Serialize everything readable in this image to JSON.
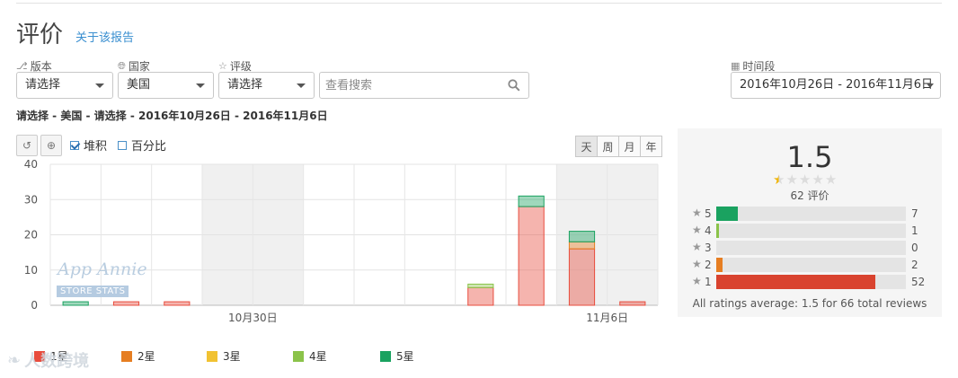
{
  "page": {
    "title": "评价",
    "about_link": "关于该报告",
    "summary": "请选择 - 美国 - 请选择 - 2016年10月26日 - 2016年11月6日"
  },
  "filters": {
    "version": {
      "label": "版本",
      "value": "请选择"
    },
    "country": {
      "label": "国家",
      "value": "美国"
    },
    "rating": {
      "label": "评级",
      "value": "请选择"
    },
    "search_placeholder": "查看搜索",
    "date": {
      "label": "时间段",
      "value": "2016年10月26日 - 2016年11月6日"
    }
  },
  "toolbar": {
    "stacked_label": "堆积",
    "stacked_checked": true,
    "percent_label": "百分比",
    "percent_checked": false,
    "periods": [
      "天",
      "周",
      "月",
      "年"
    ]
  },
  "watermark": {
    "brand": "App Annie",
    "sub": "STORE STATS"
  },
  "corner_logo": "人数跨境",
  "legend": [
    {
      "label": "1星",
      "color": "#e84c3d"
    },
    {
      "label": "2星",
      "color": "#e67e22"
    },
    {
      "label": "3星",
      "color": "#f1c232"
    },
    {
      "label": "4星",
      "color": "#8bc34a"
    },
    {
      "label": "5星",
      "color": "#1aa260"
    }
  ],
  "chart_data": {
    "type": "bar",
    "stacked": true,
    "categories": [
      "10月26日",
      "10月27日",
      "10月28日",
      "10月29日",
      "10月30日",
      "10月31日",
      "11月1日",
      "11月2日",
      "11月3日",
      "11月4日",
      "11月5日",
      "11月6日"
    ],
    "x_tick_labels": [
      {
        "category": "10月30日",
        "label": "10月30日"
      },
      {
        "category": "11月6日",
        "label": "11月6日"
      }
    ],
    "series": [
      {
        "name": "1星",
        "color": "#e84c3d",
        "values": [
          0,
          1,
          1,
          0,
          0,
          0,
          0,
          0,
          5,
          28,
          16,
          1
        ]
      },
      {
        "name": "2星",
        "color": "#e67e22",
        "values": [
          0,
          0,
          0,
          0,
          0,
          0,
          0,
          0,
          0,
          0,
          2,
          0
        ]
      },
      {
        "name": "3星",
        "color": "#f1c232",
        "values": [
          0,
          0,
          0,
          0,
          0,
          0,
          0,
          0,
          0,
          0,
          0,
          0
        ]
      },
      {
        "name": "4星",
        "color": "#8bc34a",
        "values": [
          0,
          0,
          0,
          0,
          0,
          0,
          0,
          0,
          1,
          0,
          0,
          0
        ]
      },
      {
        "name": "5星",
        "color": "#1aa260",
        "values": [
          1,
          0,
          0,
          0,
          0,
          0,
          0,
          0,
          0,
          3,
          3,
          0
        ]
      }
    ],
    "ylim": [
      0,
      40
    ],
    "yticks": [
      0,
      10,
      20,
      30,
      40
    ],
    "weekend_shading": [
      "10月29日",
      "10月30日",
      "11月5日",
      "11月6日"
    ],
    "grid": true
  },
  "rating_summary": {
    "average": "1.5",
    "average_value": 1.5,
    "ratings_count_text": "62 评价",
    "distribution": [
      {
        "star": "5",
        "count": 7,
        "color": "#1aa260",
        "fraction": 0.115
      },
      {
        "star": "4",
        "count": 1,
        "color": "#8bc34a",
        "fraction": 0.016
      },
      {
        "star": "3",
        "count": 0,
        "color": "#f1c232",
        "fraction": 0
      },
      {
        "star": "2",
        "count": 2,
        "color": "#e67e22",
        "fraction": 0.033
      },
      {
        "star": "1",
        "count": 52,
        "color": "#d9432f",
        "fraction": 0.84
      }
    ],
    "all_ratings_text": "All ratings average: 1.5 for 66 total reviews"
  }
}
